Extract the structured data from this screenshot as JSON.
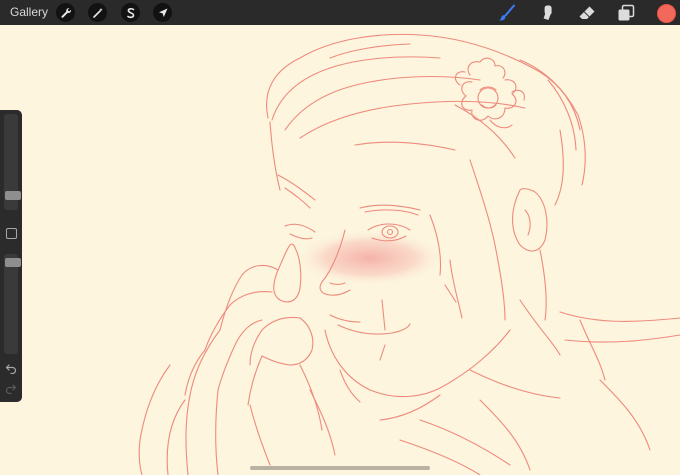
{
  "topbar": {
    "gallery_label": "Gallery",
    "left_tools": [
      {
        "name": "actions",
        "icon": "wrench-icon"
      },
      {
        "name": "adjustments",
        "icon": "magic-wand-icon"
      },
      {
        "name": "selection",
        "icon": "selection-s-icon"
      },
      {
        "name": "transform",
        "icon": "arrow-cursor-icon"
      }
    ],
    "right_tools": [
      {
        "name": "brush",
        "icon": "brush-icon",
        "active": true,
        "color": "#3b7cf5"
      },
      {
        "name": "smudge",
        "icon": "smudge-finger-icon"
      },
      {
        "name": "eraser",
        "icon": "eraser-icon"
      },
      {
        "name": "layers",
        "icon": "layers-icon"
      }
    ],
    "current_color": "#f2685a"
  },
  "sidebar": {
    "brush_size_level": 0.15,
    "opacity_level": 0.95,
    "icons": [
      "modify-square-icon",
      "undo-icon",
      "redo-icon"
    ]
  },
  "canvas": {
    "background": "#fdf5de",
    "sketch_color": "#ee8a7d",
    "blush_color": "#f4a6a0"
  }
}
